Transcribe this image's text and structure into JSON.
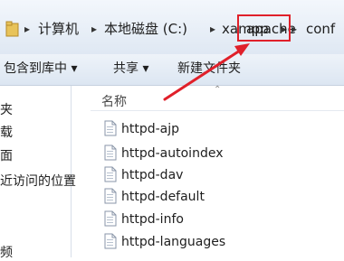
{
  "address": {
    "crumbs": [
      "计算机",
      "本地磁盘 (C:)",
      "xampp",
      "apache",
      "conf"
    ]
  },
  "toolbar": {
    "include_library": "包含到库中 ▾",
    "share": "共享 ▾",
    "new_folder": "新建文件夹"
  },
  "nav": {
    "items": [
      "夹",
      "载",
      "面",
      "近访问的位置",
      "频"
    ]
  },
  "file_list": {
    "column_name": "名称",
    "files": [
      "httpd-ajp",
      "httpd-autoindex",
      "httpd-dav",
      "httpd-default",
      "httpd-info",
      "httpd-languages"
    ]
  },
  "colors": {
    "highlight": "#e0202a",
    "arrow": "#e0202a"
  }
}
